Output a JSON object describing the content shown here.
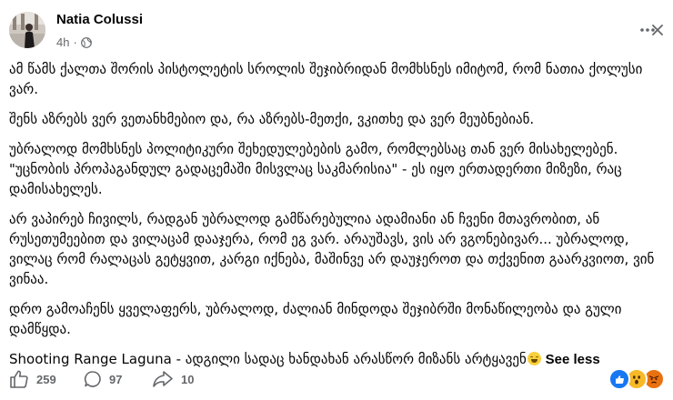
{
  "post": {
    "author": "Natia Colussi",
    "time": "4h",
    "separator": "·",
    "privacy_icon": "globe-icon",
    "paragraphs": [
      "ამ წამს ქალთა შორის პისტოლეტის სროლის შეჯიბრიდან მომხსნეს იმიტომ, რომ ნათია ქოლუსი ვარ.",
      "შენს აზრებს ვერ ვეთანხმებიო და, რა აზრებს-მეთქი, ვკითხე და ვერ მეუბნებიან.",
      "უბრალოდ მომხსნეს პოლიტიკური შეხედულებების გამო, რომლებსაც თან ვერ მისახელებენ. \"უცნობის პროპაგანდულ გადაცემაში მისვლაც საკმარისია\" - ეს იყო ერთადერთი მიზეზი, რაც დამისახელეს.",
      "არ ვაპირებ ჩივილს, რადგან უბრალოდ გამწარებულია ადამიანი ან ჩვენი მთავრობით, ან რუსეთუმეებით და ვილაცამ დააჯერა, რომ ეგ ვარ. არაუშავს, ვის არ ვგონებივარ... უბრალოდ, ვილაც რომ რალაცას გეტყვით, კარგი იქნება, მაშინვე არ დაუჯეროთ და თქვენით გაარკვიოთ, ვინ ვინაა.",
      "დრო გამოაჩენს ყველაფერს, უბრალოდ, ძალიან მინდოდა შეჯიბრში მონაწილეობა და გული დამწყდა."
    ],
    "last_line": "Shooting Range Laguna - ადგილი სადაც ხანდახან არასწორ მიზანს არტყავენ",
    "last_line_emoji": "grinning-sweat-emoji",
    "see_less": "See less"
  },
  "footer": {
    "likes": "259",
    "comments": "97",
    "shares": "10",
    "reactions": [
      "like-reaction-icon",
      "wow-reaction-icon",
      "angry-reaction-icon"
    ]
  },
  "colors": {
    "text": "#050505",
    "secondary": "#65676b",
    "like_blue": "#1877f2",
    "wow_yellow": "#f7b928",
    "angry_orange": "#e9710f"
  }
}
